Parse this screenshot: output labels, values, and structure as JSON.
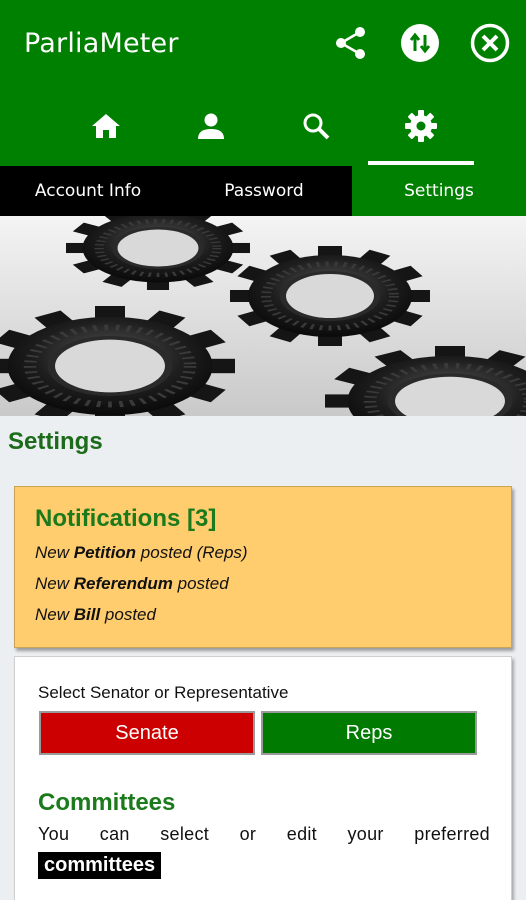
{
  "app": {
    "title": "ParliaMeter"
  },
  "toolbar": {
    "icons": [
      "share-icon",
      "sync-icon",
      "close-icon"
    ]
  },
  "nav": {
    "icons": [
      "home-icon",
      "user-icon",
      "search-icon",
      "gear-icon"
    ],
    "active": "settings"
  },
  "tabs": [
    {
      "label": "Account Info",
      "active": false
    },
    {
      "label": "Password",
      "active": false
    },
    {
      "label": "Settings",
      "active": true
    }
  ],
  "section": {
    "title": "Settings"
  },
  "notifications": {
    "title": "Notifications [3]",
    "items": [
      {
        "prefix": "New ",
        "emphasis": "Petition",
        "suffix": " posted (Reps)"
      },
      {
        "prefix": "New ",
        "emphasis": "Referendum",
        "suffix": " posted"
      },
      {
        "prefix": "New ",
        "emphasis": "Bill",
        "suffix": " posted"
      }
    ]
  },
  "chamber": {
    "label": "Select Senator or Representative",
    "senate_label": "Senate",
    "reps_label": "Reps"
  },
  "committees": {
    "title": "Committees",
    "text": "You can select or edit your preferred",
    "tag": "committees"
  },
  "colors": {
    "primary_green": "#008000",
    "tab_black": "#000000",
    "notif_bg": "#ffcc6e",
    "senate_red": "#cc0000",
    "reps_green": "#007a00",
    "heading_green": "#1b7a1b"
  }
}
